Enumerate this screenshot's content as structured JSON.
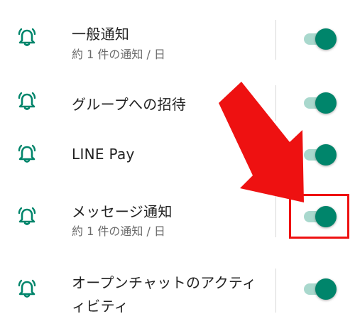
{
  "colors": {
    "accent": "#00856b",
    "accent_track": "#a9d8cd",
    "annotation_red": "#ee1111",
    "text_primary": "#222222",
    "text_secondary": "#6b6b6b"
  },
  "settings": [
    {
      "icon": "bell-ringing-icon",
      "title": "一般通知",
      "subtitle": "約 1 件の通知 / 日",
      "enabled": true
    },
    {
      "icon": "bell-ringing-icon",
      "title": "グループへの招待",
      "subtitle": "",
      "enabled": true
    },
    {
      "icon": "bell-ringing-icon",
      "title": "LINE Pay",
      "subtitle": "",
      "enabled": true
    },
    {
      "icon": "bell-ringing-icon",
      "title": "メッセージ通知",
      "subtitle": "約 1 件の通知 / 日",
      "enabled": true,
      "highlighted": true
    },
    {
      "icon": "bell-ringing-icon",
      "title": "オープンチャットのアクティ",
      "title_line2": "ィビティ",
      "subtitle": "",
      "enabled": true
    }
  ],
  "annotation": {
    "type": "red-arrow",
    "target": "メッセージ通知"
  }
}
